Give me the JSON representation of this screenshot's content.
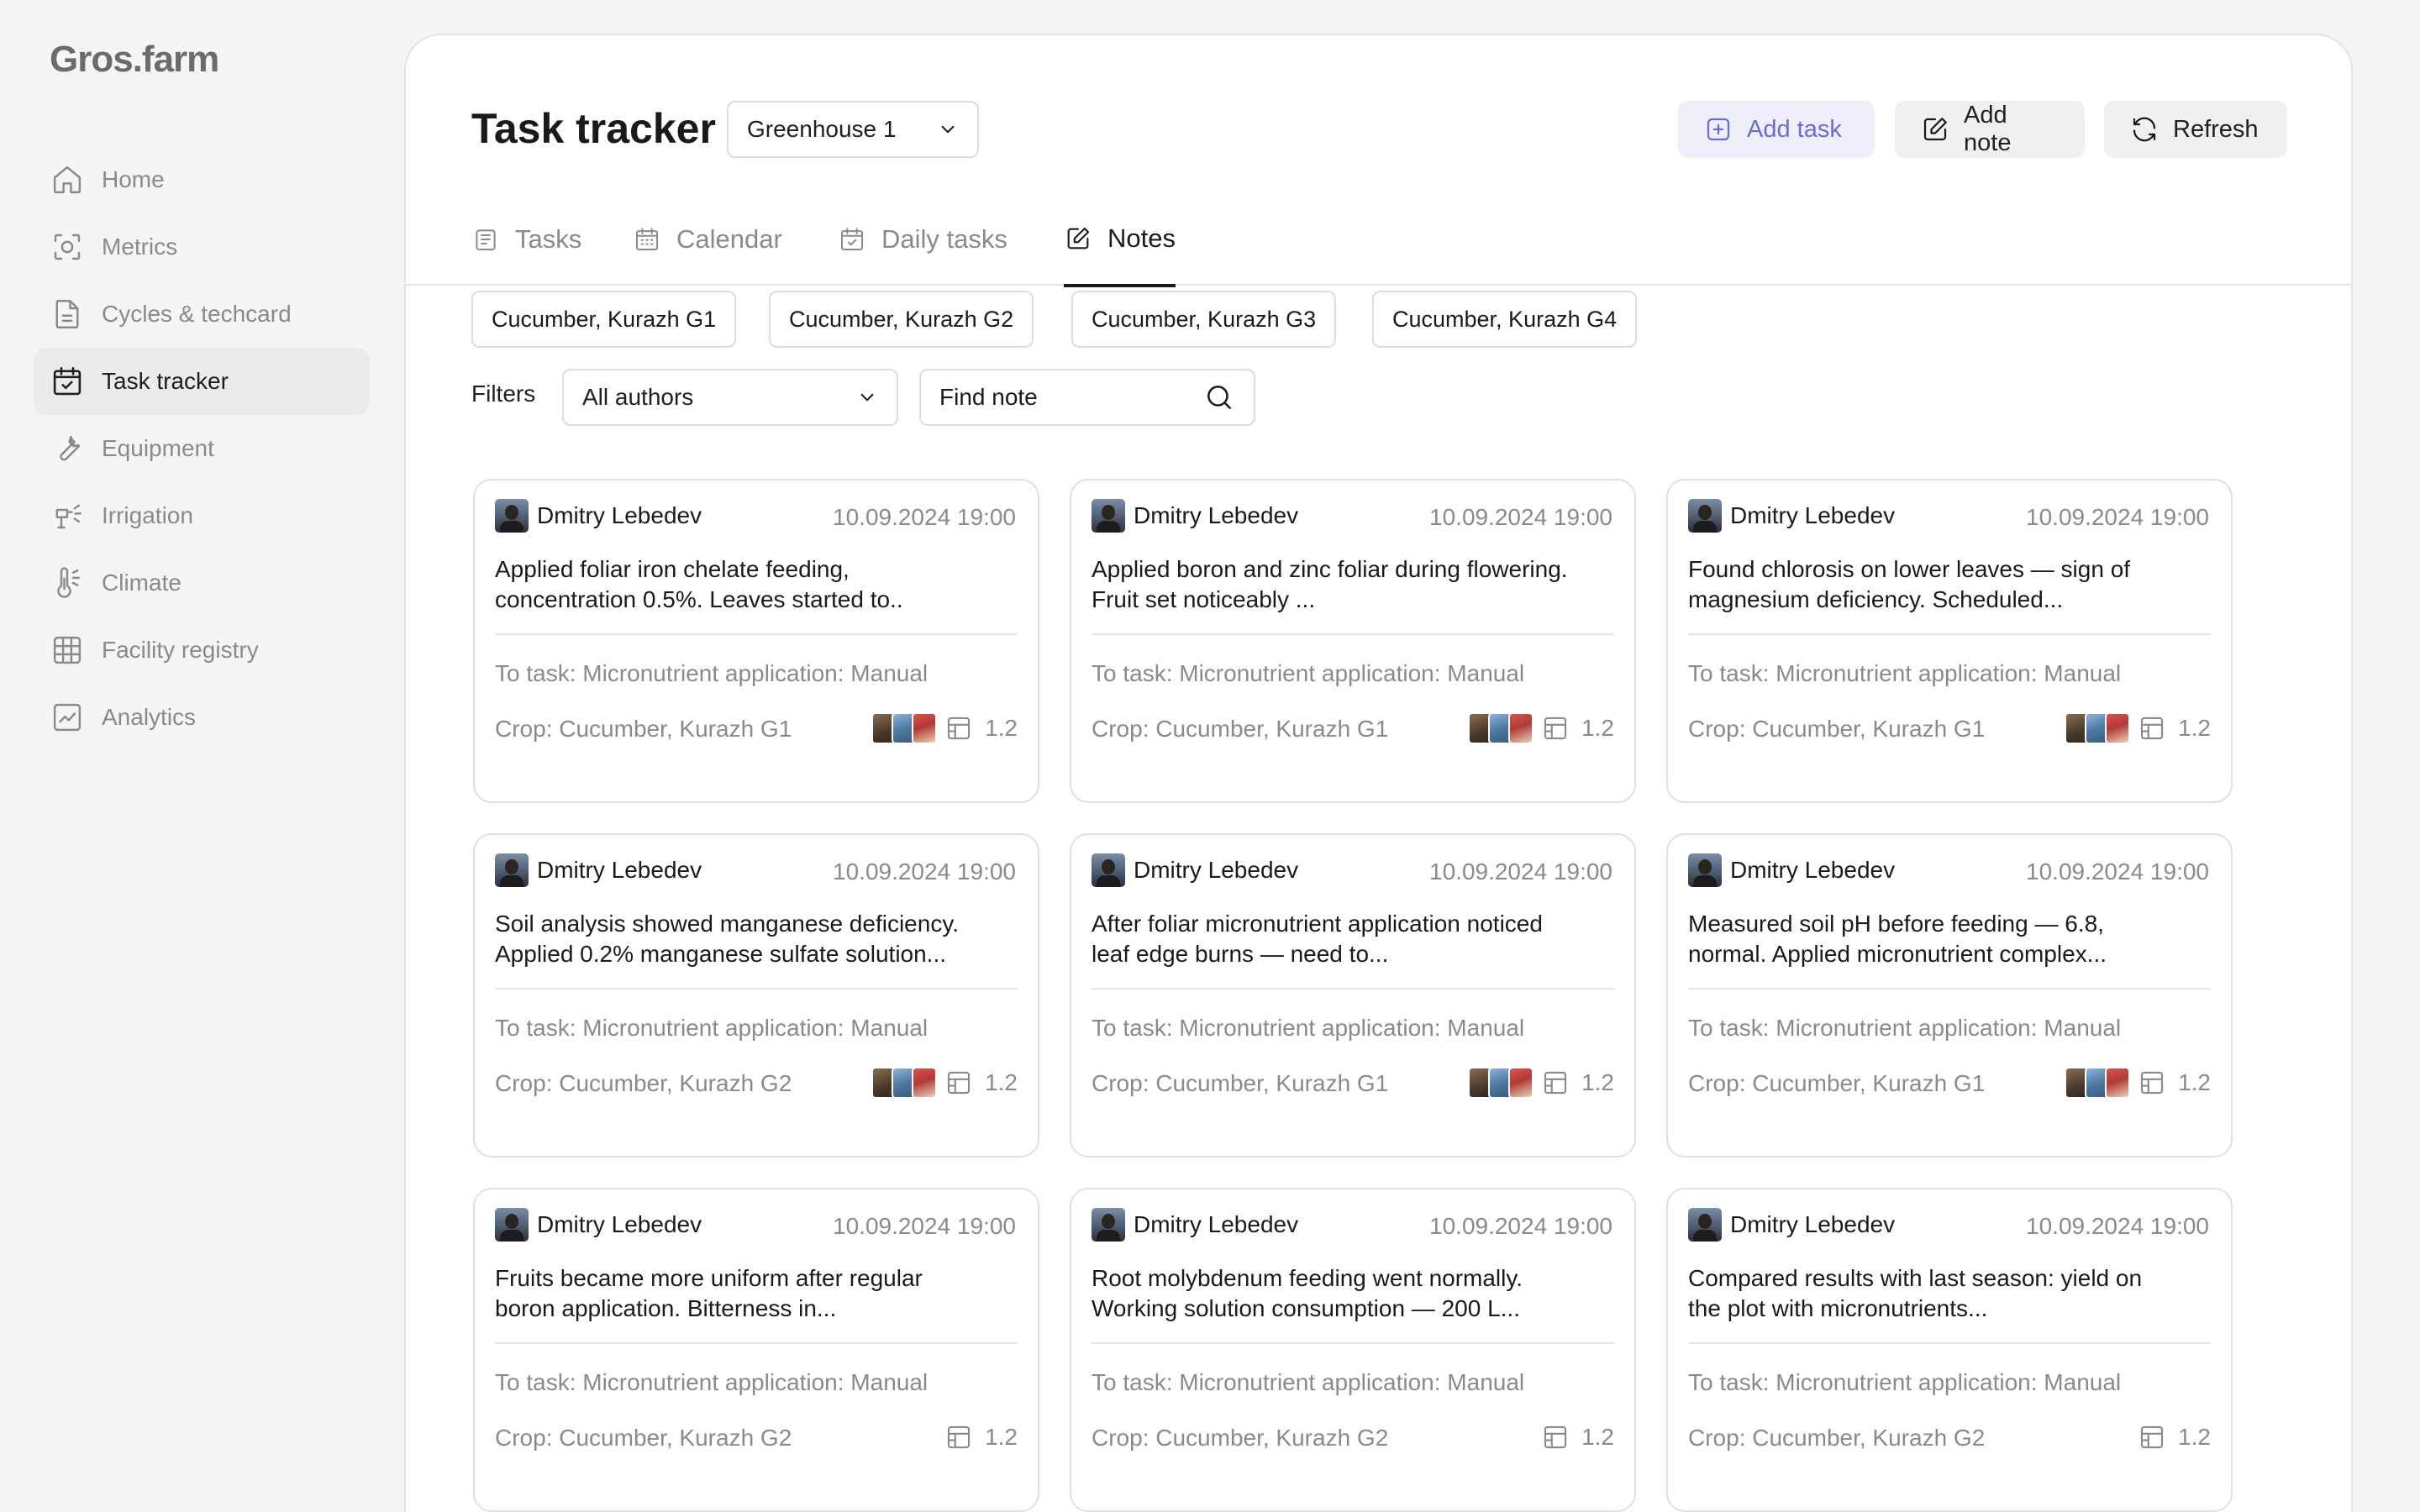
{
  "brand": {
    "logo": "Gros.farm"
  },
  "sidebar": {
    "items": [
      {
        "label": "Home",
        "icon": "home-icon"
      },
      {
        "label": "Metrics",
        "icon": "metrics-icon"
      },
      {
        "label": "Cycles & techcard",
        "icon": "document-icon"
      },
      {
        "label": "Task tracker",
        "icon": "calendar-check-icon",
        "active": true
      },
      {
        "label": "Equipment",
        "icon": "wrench-icon"
      },
      {
        "label": "Irrigation",
        "icon": "sprinkler-icon"
      },
      {
        "label": "Climate",
        "icon": "thermometer-icon"
      },
      {
        "label": "Facility registry",
        "icon": "grid-icon"
      },
      {
        "label": "Analytics",
        "icon": "chart-icon"
      }
    ]
  },
  "header": {
    "title": "Task tracker",
    "greenhouse_select": "Greenhouse 1",
    "add_task_label": "Add task",
    "add_note_label": "Add note",
    "refresh_label": "Refresh",
    "accent_color": "#6b6bd6"
  },
  "tabs": [
    {
      "label": "Tasks",
      "icon": "clipboard-icon"
    },
    {
      "label": "Calendar",
      "icon": "calendar-icon"
    },
    {
      "label": "Daily tasks",
      "icon": "calendar-check-icon"
    },
    {
      "label": "Notes",
      "icon": "edit-icon",
      "active": true
    }
  ],
  "crop_chips": [
    "Cucumber, Kurazh G1",
    "Cucumber, Kurazh G2",
    "Cucumber, Kurazh G3",
    "Cucumber, Kurazh G4"
  ],
  "filters": {
    "label": "Filters",
    "author_select": "All authors",
    "search_placeholder": "Find note"
  },
  "notes": [
    {
      "author": "Dmitry Lebedev",
      "date": "10.09.2024 19:00",
      "line1": "Applied foliar iron chelate feeding,",
      "line2": "concentration 0.5%. Leaves started to..",
      "task": "To task: Micronutrient application: Manual",
      "crop": "Crop: Cucumber, Kurazh G1",
      "zone": "1.2",
      "has_photos": true
    },
    {
      "author": "Dmitry Lebedev",
      "date": "10.09.2024 19:00",
      "line1": "Applied boron and zinc foliar during flowering.",
      "line2": "Fruit set noticeably ...",
      "task": "To task: Micronutrient application: Manual",
      "crop": "Crop: Cucumber, Kurazh G1",
      "zone": "1.2",
      "has_photos": true
    },
    {
      "author": "Dmitry Lebedev",
      "date": "10.09.2024 19:00",
      "line1": "Found chlorosis on lower leaves — sign of",
      "line2": "magnesium deficiency. Scheduled...",
      "task": "To task: Micronutrient application: Manual",
      "crop": "Crop: Cucumber, Kurazh G1",
      "zone": "1.2",
      "has_photos": true
    },
    {
      "author": "Dmitry Lebedev",
      "date": "10.09.2024 19:00",
      "line1": "Soil analysis showed manganese deficiency.",
      "line2": "Applied 0.2% manganese sulfate solution...",
      "task": "To task: Micronutrient application: Manual",
      "crop": "Crop: Cucumber, Kurazh G2",
      "zone": "1.2",
      "has_photos": true
    },
    {
      "author": "Dmitry Lebedev",
      "date": "10.09.2024 19:00",
      "line1": "After foliar micronutrient application noticed",
      "line2": "leaf edge burns — need to...",
      "task": "To task: Micronutrient application: Manual",
      "crop": "Crop: Cucumber, Kurazh G1",
      "zone": "1.2",
      "has_photos": true
    },
    {
      "author": "Dmitry Lebedev",
      "date": "10.09.2024 19:00",
      "line1": "Measured soil pH before feeding — 6.8,",
      "line2": "normal. Applied micronutrient complex...",
      "task": "To task: Micronutrient application: Manual",
      "crop": "Crop: Cucumber, Kurazh G1",
      "zone": "1.2",
      "has_photos": true
    },
    {
      "author": "Dmitry Lebedev",
      "date": "10.09.2024 19:00",
      "line1": "Fruits became more uniform after regular",
      "line2": "boron application. Bitterness in...",
      "task": "To task: Micronutrient application: Manual",
      "crop": "Crop: Cucumber, Kurazh G2",
      "zone": "1.2",
      "has_photos": false
    },
    {
      "author": "Dmitry Lebedev",
      "date": "10.09.2024 19:00",
      "line1": "Root molybdenum feeding went normally.",
      "line2": "Working solution consumption — 200 L...",
      "task": "To task: Micronutrient application: Manual",
      "crop": "Crop: Cucumber, Kurazh G2",
      "zone": "1.2",
      "has_photos": false
    },
    {
      "author": "Dmitry Lebedev",
      "date": "10.09.2024 19:00",
      "line1": "Compared results with last season: yield on",
      "line2": "the plot with micronutrients...",
      "task": "To task: Micronutrient application: Manual",
      "crop": "Crop: Cucumber, Kurazh G2",
      "zone": "1.2",
      "has_photos": false
    }
  ]
}
